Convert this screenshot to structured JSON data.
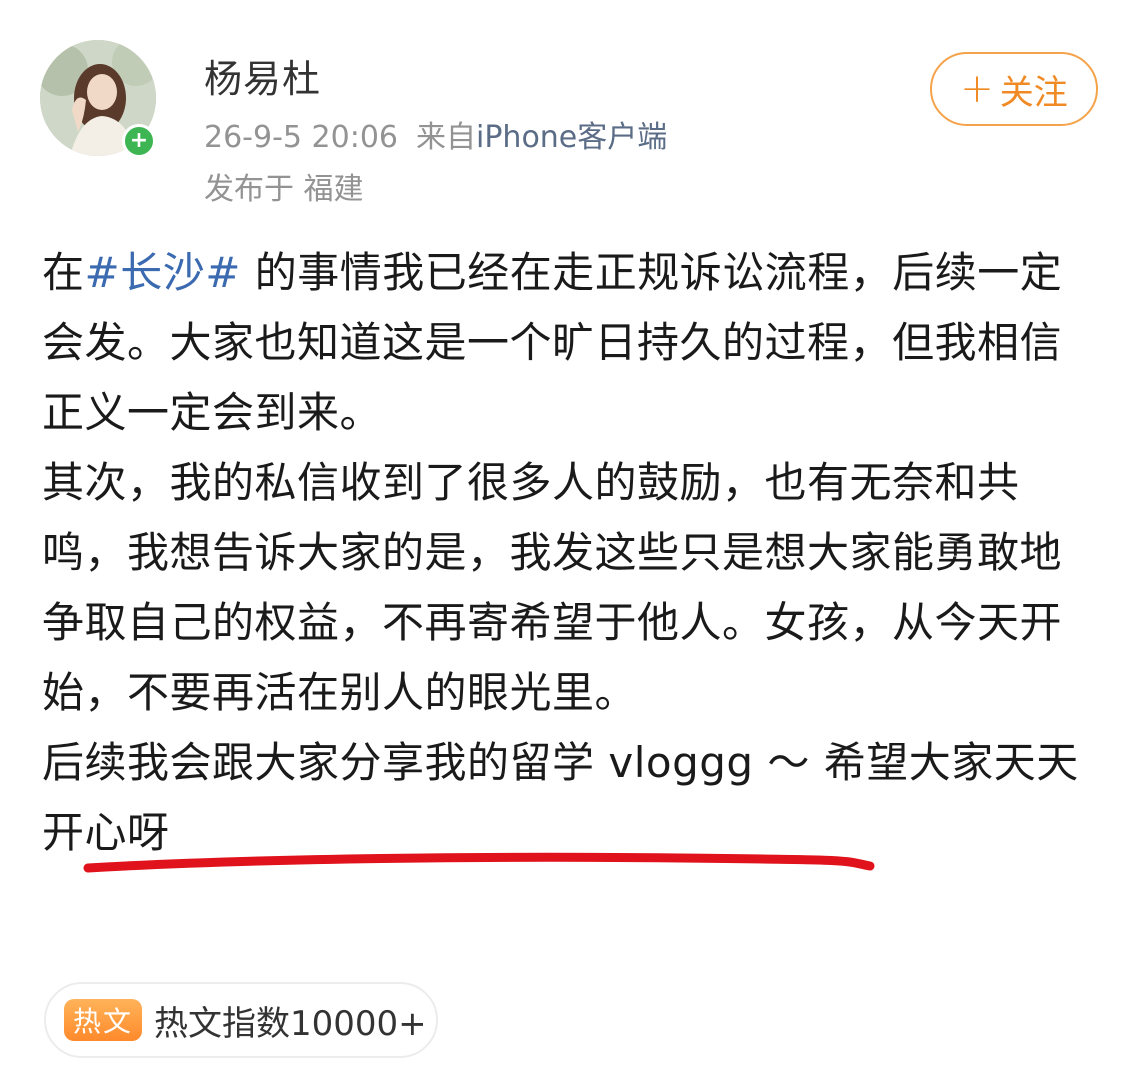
{
  "author": {
    "name": "杨易杜",
    "timestamp": "26-9-5 20:06",
    "source_label": "来自",
    "source_device": "iPhone客户端",
    "location": "发布于 福建"
  },
  "follow_button": {
    "label": "关注"
  },
  "post": {
    "line1_prefix": "在",
    "hashtag": "#长沙#",
    "line1_rest": " 的事情我已经在走正规诉讼流程，后续一定会发。大家也知道这是一个旷日持久的过程，但我相信正义一定会到来。",
    "para2": "其次，我的私信收到了很多人的鼓励，也有无奈和共鸣，我想告诉大家的是，我发这些只是想大家能勇敢地争取自己的权益，不再寄希望于他人。女孩，从今天开始，不要再活在别人的眼光里。",
    "para3": "后续我会跟大家分享我的留学 vloggg ～ 希望大家天天开心呀"
  },
  "hot_badge": {
    "icon_label": "热文",
    "text": "热文指数10000+"
  },
  "colors": {
    "accent_orange": "#f08a24",
    "hashtag_blue": "#3b6ab0",
    "meta_gray": "#939393",
    "underline_red": "#e0121b",
    "online_green": "#3cb552"
  },
  "icons": {
    "follow": "plus-icon",
    "online": "plus-badge-icon",
    "hot": "hot-article-icon"
  }
}
